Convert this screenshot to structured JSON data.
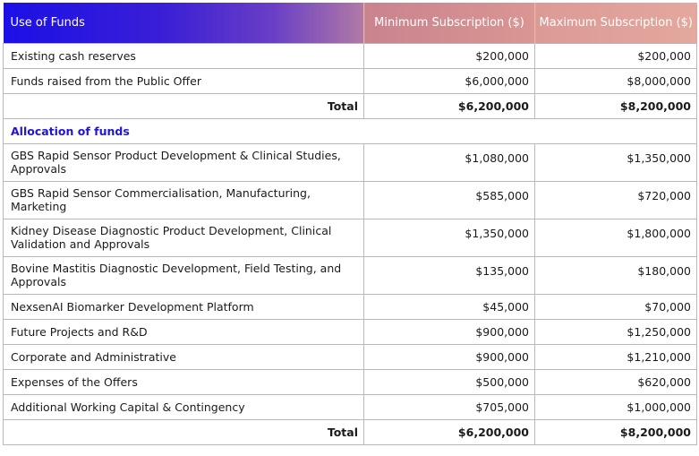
{
  "header": {
    "col1": "Use of Funds",
    "col2": "Minimum Subscription ($)",
    "col3": "Maximum Subscription ($)"
  },
  "sources": [
    {
      "label": "Existing cash reserves",
      "min": "$200,000",
      "max": "$200,000"
    },
    {
      "label": "Funds raised from the Public Offer",
      "min": "$6,000,000",
      "max": "$8,000,000"
    }
  ],
  "sources_total": {
    "label": "Total",
    "min": "$6,200,000",
    "max": "$8,200,000"
  },
  "allocation_heading": "Allocation of funds",
  "allocations": [
    {
      "label": "GBS Rapid Sensor Product Development & Clinical Studies, Approvals",
      "min": "$1,080,000",
      "max": "$1,350,000"
    },
    {
      "label": "GBS Rapid Sensor Commercialisation, Manufacturing, Marketing",
      "min": "$585,000",
      "max": "$720,000"
    },
    {
      "label": "Kidney Disease Diagnostic Product Development, Clinical Validation and Approvals",
      "min": "$1,350,000",
      "max": "$1,800,000"
    },
    {
      "label": "Bovine Mastitis Diagnostic Development, Field Testing, and Approvals",
      "min": "$135,000",
      "max": "$180,000"
    },
    {
      "label": "NexsenAI Biomarker Development Platform",
      "min": "$45,000",
      "max": "$70,000"
    },
    {
      "label": "Future Projects and R&D",
      "min": "$900,000",
      "max": "$1,250,000"
    },
    {
      "label": "Corporate and Administrative",
      "min": "$900,000",
      "max": "$1,210,000"
    },
    {
      "label": "Expenses of the Offers",
      "min": "$500,000",
      "max": "$620,000"
    },
    {
      "label": "Additional Working Capital & Contingency",
      "min": "$705,000",
      "max": "$1,000,000"
    }
  ],
  "allocations_total": {
    "label": "Total",
    "min": "$6,200,000",
    "max": "$8,200,000"
  },
  "colors": {
    "header_blue": "#1c10e6",
    "header_pink": "#d99692",
    "section_heading": "#1f15d6"
  }
}
